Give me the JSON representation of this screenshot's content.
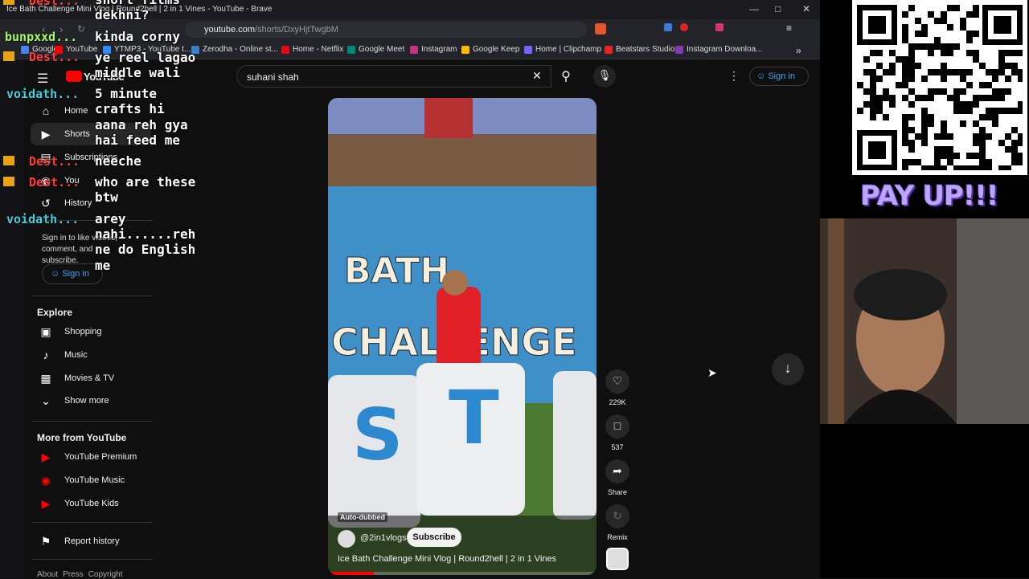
{
  "browser": {
    "title": "Ice Bath Challenge Mini Vlog | Round2hell | 2 in 1 Vines - YouTube - Brave",
    "url_host": "youtube.com",
    "url_path": "/shorts/DxyHjtTwgbM",
    "bookmarks": [
      "Google",
      "YouTube",
      "YTMP3 - YouTube t...",
      "Zerodha - Online st...",
      "Home - Netflix",
      "Google Meet",
      "Instagram",
      "Google Keep",
      "Home | Clipchamp",
      "Beatstars Studio",
      "Instagram Downloa..."
    ]
  },
  "youtube": {
    "logo": "YouTube",
    "search_value": "suhani shah",
    "signin": "Sign in",
    "nav": [
      "Home",
      "Shorts",
      "Subscriptions",
      "You",
      "History"
    ],
    "signin_prompt": "Sign in to like videos, comment, and subscribe.",
    "signin_side": "Sign in",
    "explore_title": "Explore",
    "explore": [
      "Shopping",
      "Music",
      "Movies & TV",
      "Show more"
    ],
    "more_title": "More from YouTube",
    "more": [
      "YouTube Premium",
      "YouTube Music",
      "YouTube Kids"
    ],
    "report": "Report history",
    "footer": [
      "About",
      "Press",
      "Copyright"
    ]
  },
  "short": {
    "auto_dubbed": "Auto-dubbed",
    "channel": "@2in1vlogs",
    "subscribe": "Subscribe",
    "title": "Ice Bath Challenge Mini Vlog | Round2hell | 2 in 1 Vines",
    "likes": "229K",
    "comments": "537",
    "share": "Share",
    "remix": "Remix",
    "progress": 0.17
  },
  "overlay": {
    "chat_lines": [
      "short films",
      "dekhni?",
      "kinda corny",
      "ye reel lagao",
      "middle wali",
      "5 minute",
      "crafts hi",
      "aana reh gya",
      "hai feed me",
      "neeche",
      "who are these",
      "btw",
      "arey",
      "nahi......reh",
      "ne do English",
      "me"
    ],
    "users": [
      "Dest...",
      "bunpxxd...",
      "Dest...",
      "voidath...",
      "Dest...",
      "Dest...",
      "voidath..."
    ],
    "payup": "PAY UP!!!"
  },
  "colors": {
    "accent": "#3ea6ff",
    "yt_red": "#ff0000",
    "payup": "#b9a6ff"
  }
}
